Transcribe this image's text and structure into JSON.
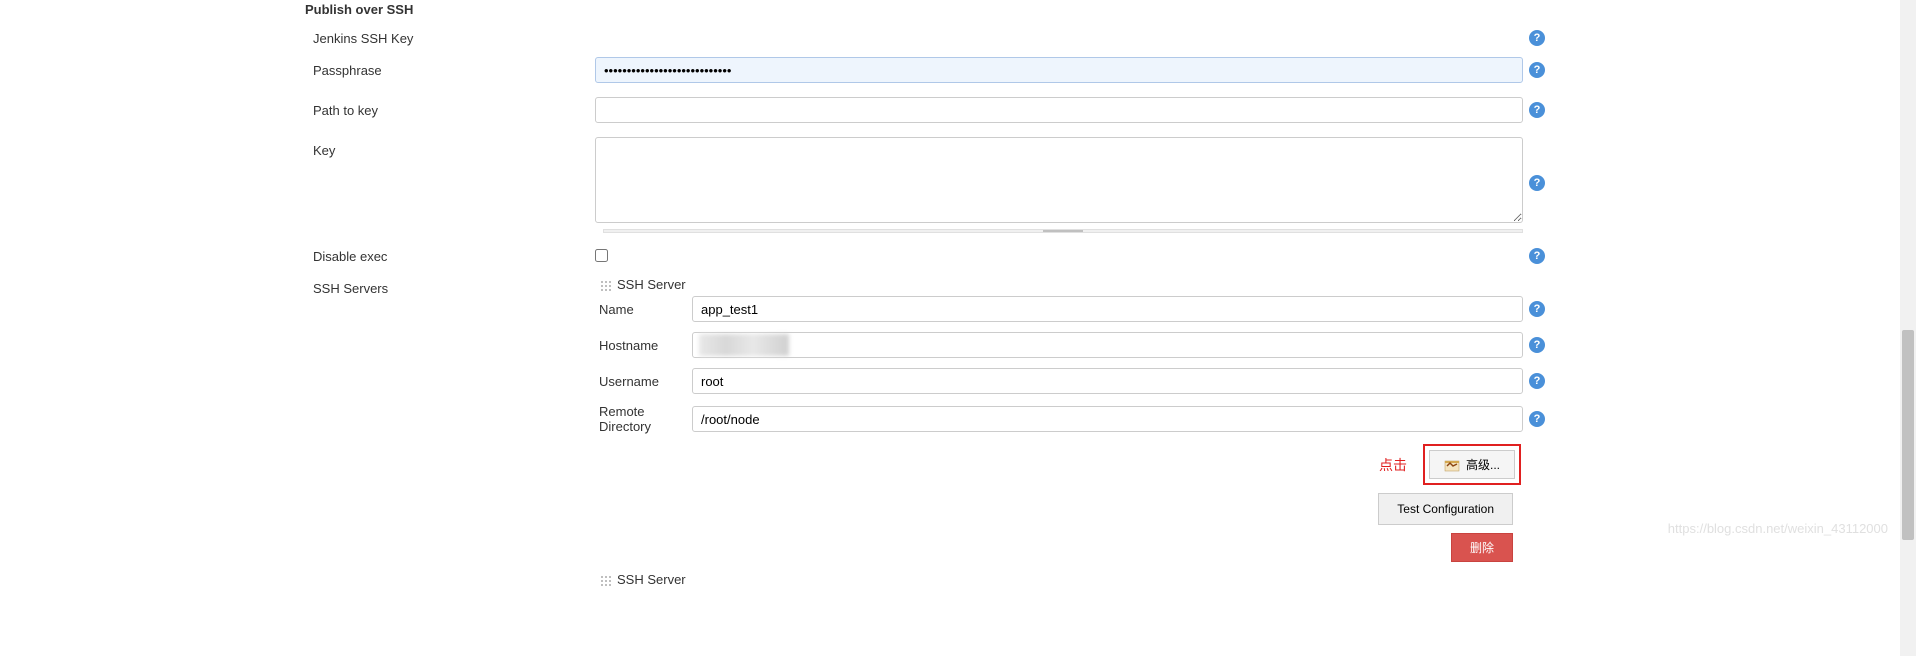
{
  "section_title": "Publish over SSH",
  "labels": {
    "jenkins_ssh_key": "Jenkins SSH Key",
    "passphrase": "Passphrase",
    "path_to_key": "Path to key",
    "key": "Key",
    "disable_exec": "Disable exec",
    "ssh_servers": "SSH Servers"
  },
  "values": {
    "passphrase": "••••••••••••••••••••••••••••",
    "path_to_key": "",
    "key": ""
  },
  "ssh_server": {
    "header": "SSH Server",
    "labels": {
      "name": "Name",
      "hostname": "Hostname",
      "username": "Username",
      "remote_directory": "Remote Directory"
    },
    "values": {
      "name": "app_test1",
      "username": "root",
      "remote_directory": "/root/node"
    }
  },
  "buttons": {
    "advanced": "高级...",
    "test_configuration": "Test Configuration",
    "delete": "删除"
  },
  "annotation": {
    "click_text": "点击"
  },
  "help_icon_glyph": "?",
  "watermark": "https://blog.csdn.net/weixin_43112000",
  "ssh_server_header_2": "SSH Server"
}
